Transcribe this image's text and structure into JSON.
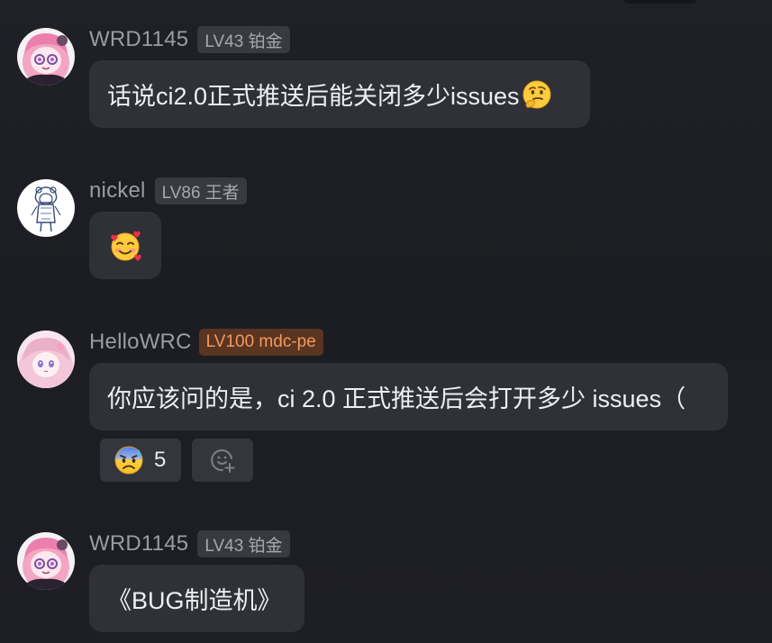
{
  "messages": [
    {
      "username": "WRD1145",
      "level": "LV43 铂金",
      "text": "话说ci2.0正式推送后能关闭多少issues",
      "emoji": "thinking-face"
    },
    {
      "username": "nickel",
      "level": "LV86 王者",
      "emoji": "smiling-face-with-hearts"
    },
    {
      "username": "HelloWRC",
      "level": "LV100 mdc-pe",
      "text": "你应该问的是，ci 2.0 正式推送后会打开多少 issues（",
      "reactions": [
        {
          "emoji": "anxious-face-with-sweat",
          "count": "5"
        }
      ],
      "add_reaction_icon": "add-reaction-icon"
    },
    {
      "username": "WRD1145",
      "level": "LV43 铂金",
      "text": "《BUG制造机》"
    }
  ],
  "colors": {
    "background": "#1d1f24",
    "bubble": "#2f3136",
    "badge": "#383a40",
    "badge_orange_bg": "#5a3522",
    "badge_orange_text": "#f39a5c"
  }
}
